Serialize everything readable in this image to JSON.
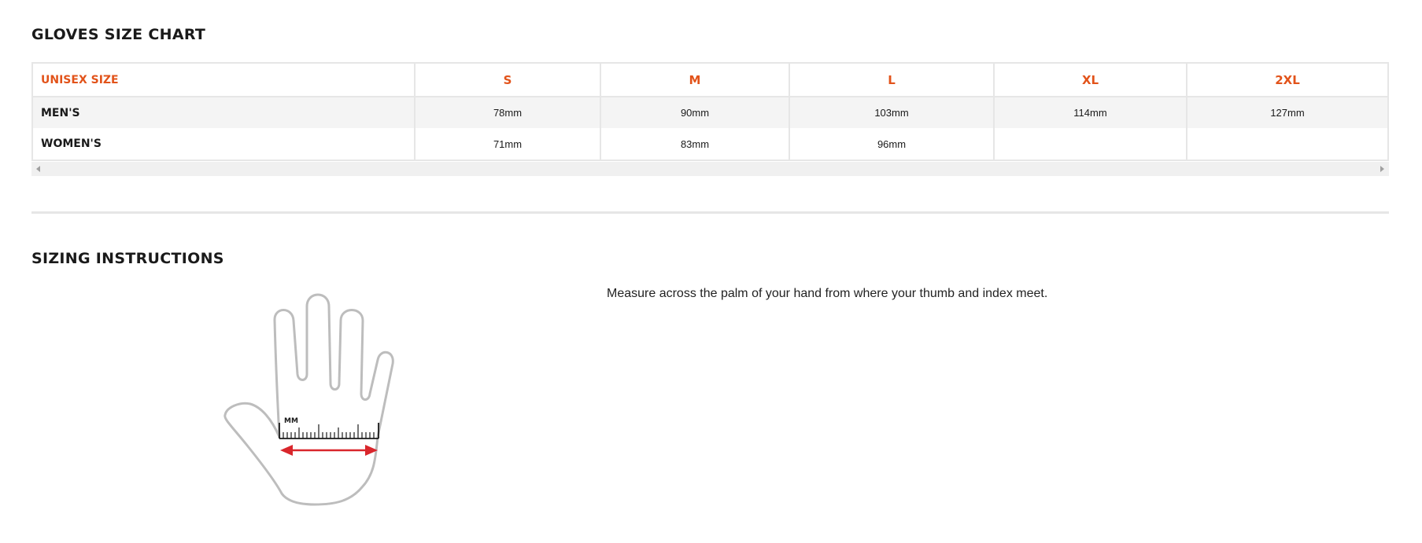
{
  "size_chart": {
    "title": "GLOVES SIZE CHART",
    "columns": [
      "UNISEX SIZE",
      "S",
      "M",
      "L",
      "XL",
      "2XL"
    ],
    "rows": [
      {
        "label": "MEN'S",
        "values": [
          "78mm",
          "90mm",
          "103mm",
          "114mm",
          "127mm"
        ]
      },
      {
        "label": "WOMEN'S",
        "values": [
          "71mm",
          "83mm",
          "96mm",
          "",
          ""
        ]
      }
    ]
  },
  "instructions": {
    "title": "SIZING INSTRUCTIONS",
    "text": "Measure across the palm of your hand from where your thumb and index meet.",
    "ruler_label": "MM"
  },
  "colors": {
    "accent": "#e2531a",
    "arrow": "#d9262c",
    "border": "#e6e6e6",
    "row_shade": "#f4f4f4"
  },
  "icons": {
    "illustration": "hand-measurement-icon",
    "scroll_left": "triangle-left-icon",
    "scroll_right": "triangle-right-icon"
  }
}
